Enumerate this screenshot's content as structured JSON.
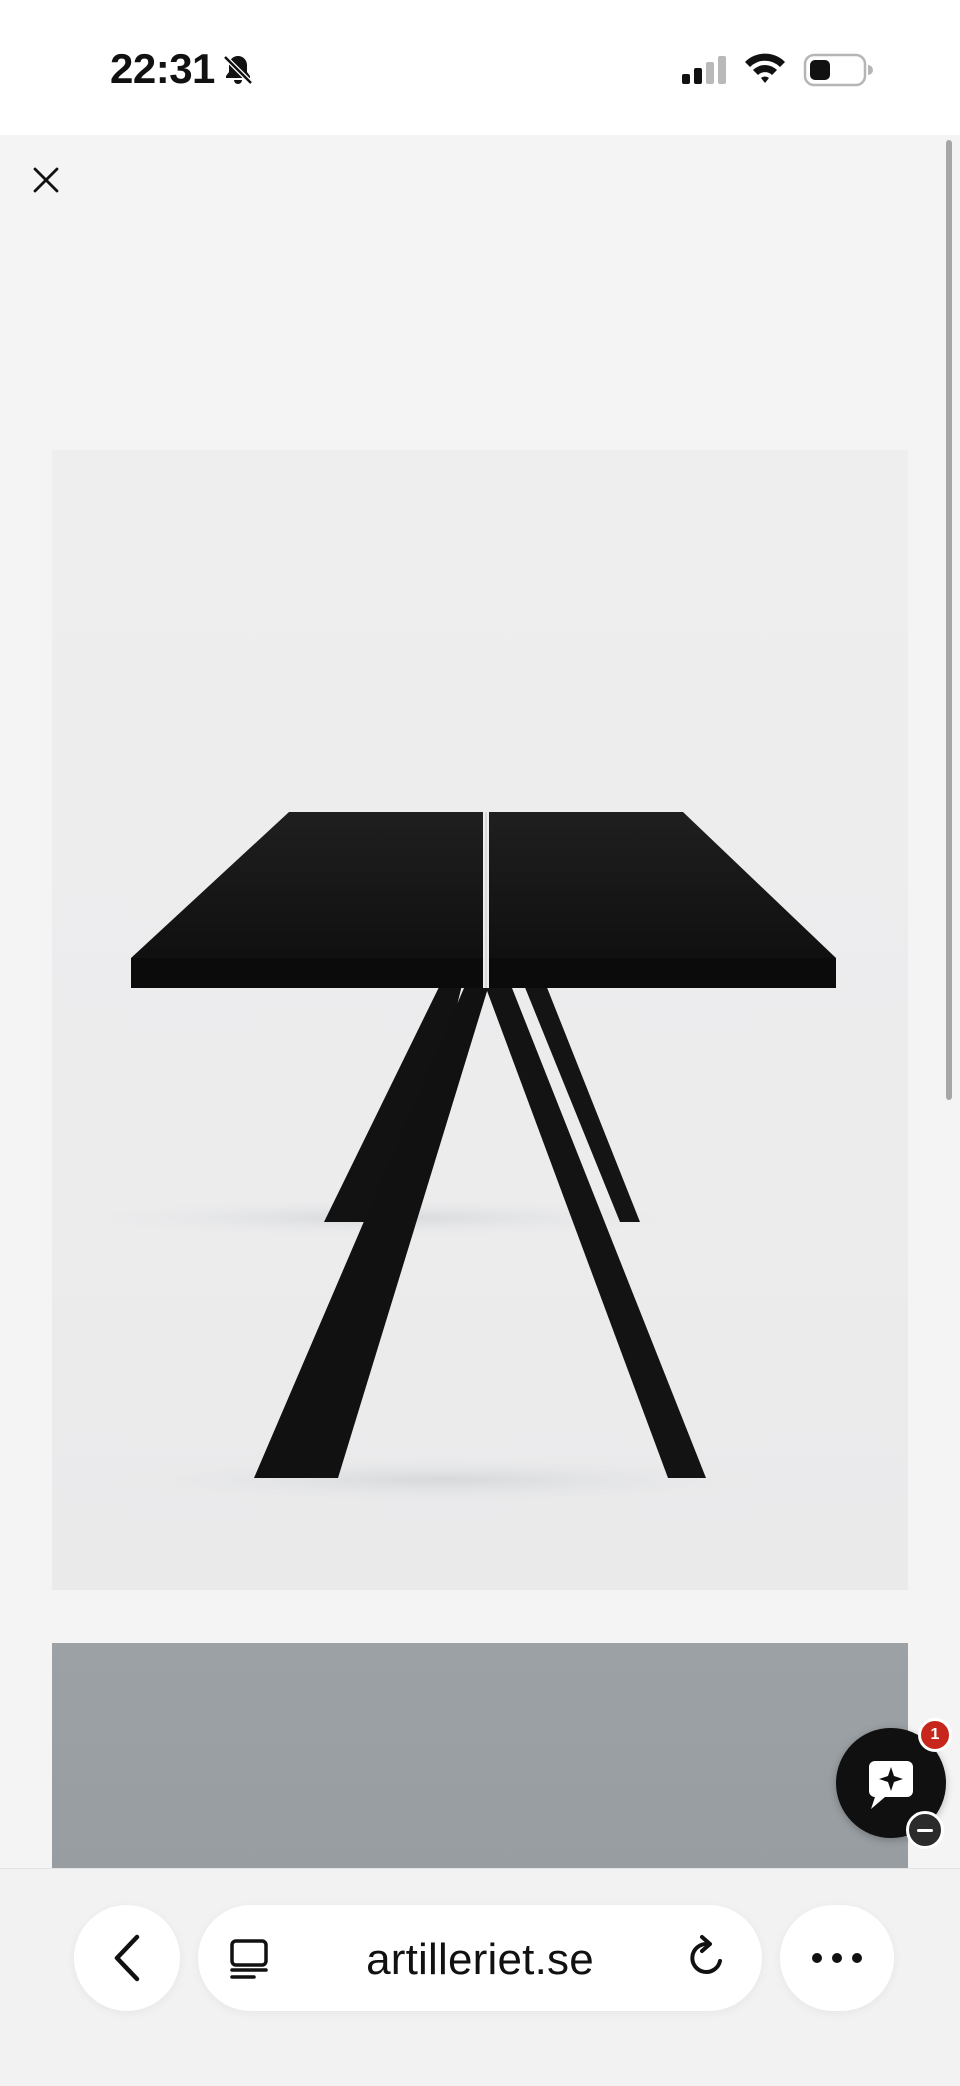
{
  "status_bar": {
    "time": "22:31",
    "icons": [
      "bell-slash-icon",
      "cellular-signal-icon",
      "wifi-icon",
      "battery-icon"
    ]
  },
  "viewer": {
    "close_icon": "close-icon",
    "images": [
      {
        "subject": "black-wooden-table-photo"
      },
      {
        "subject": "grey-textured-photo"
      }
    ]
  },
  "chat_widget": {
    "badge_count": "1",
    "icon": "chat-sparkle-icon",
    "minimize_icon": "minus-icon"
  },
  "browser_toolbar": {
    "back_icon": "chevron-left-icon",
    "tabs_icon": "tabs-icon",
    "url": "artilleriet.se",
    "reload_icon": "reload-icon",
    "more_icon": "more-dots-icon"
  },
  "colors": {
    "background": "#f4f4f4",
    "photo_background": "#ececed",
    "table_black": "#141414",
    "badge_red": "#c8261d",
    "chat_button": "#101010"
  }
}
